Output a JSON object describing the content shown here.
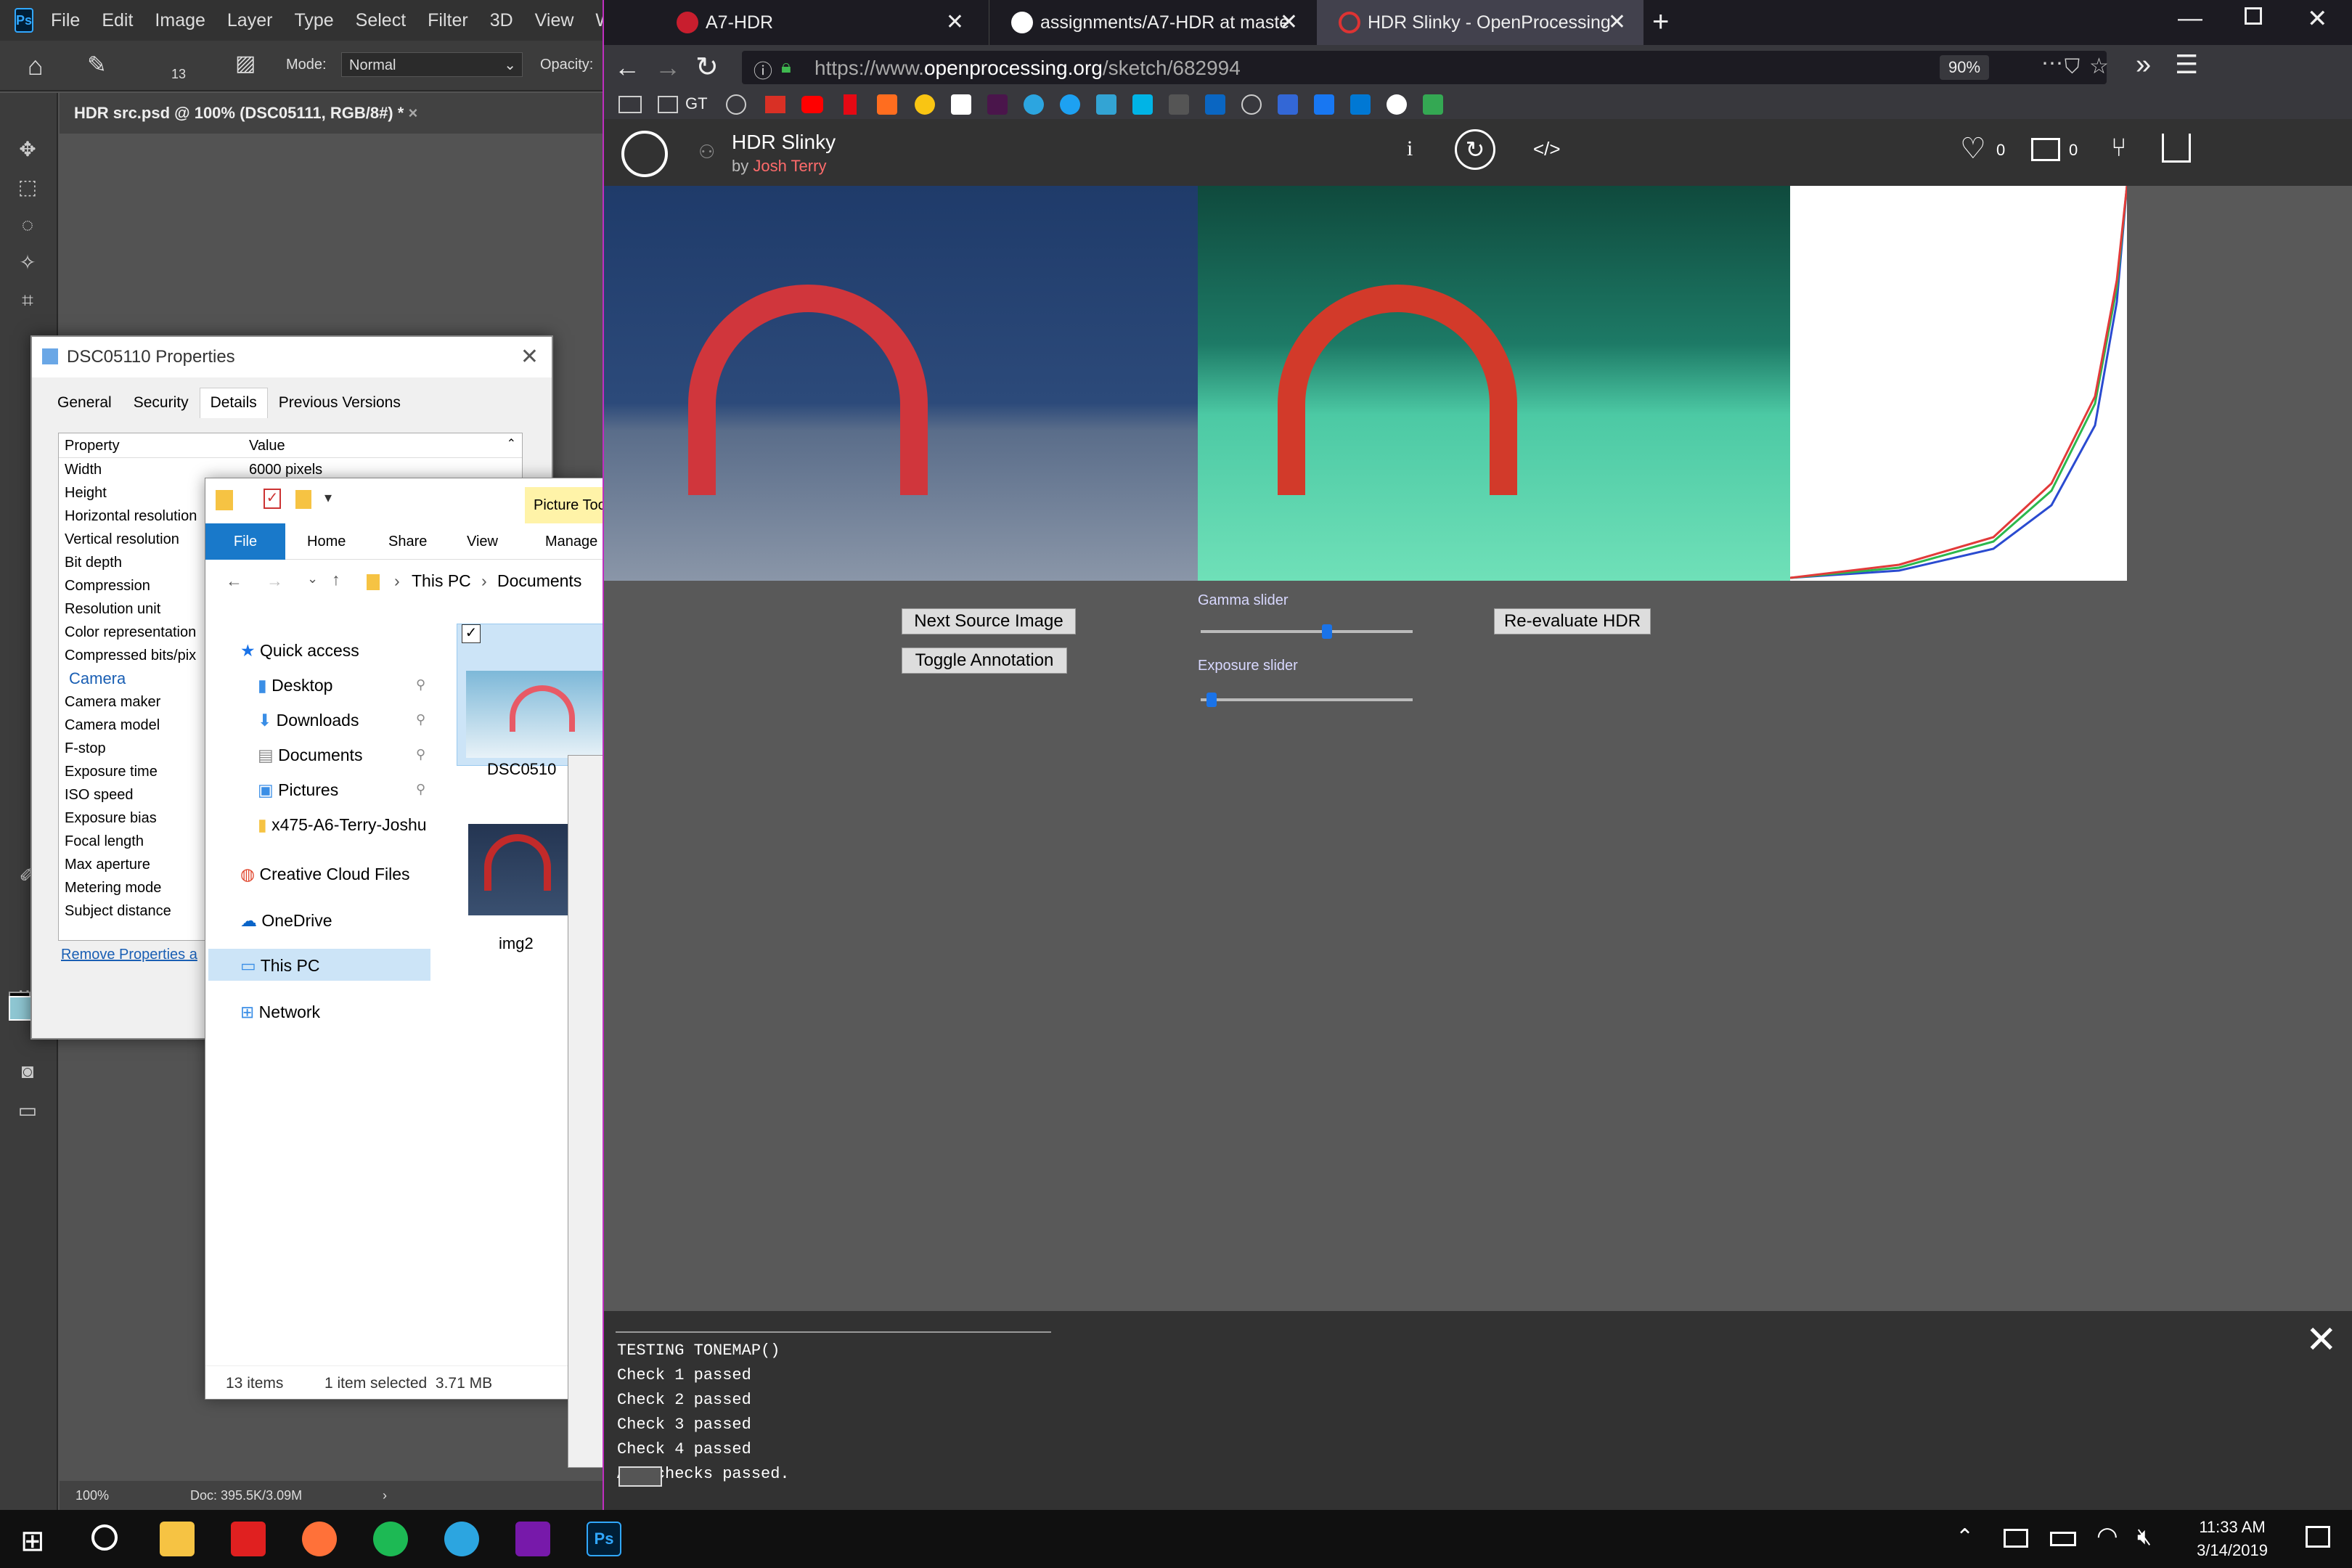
{
  "photoshop": {
    "logo": "Ps",
    "menus": [
      "File",
      "Edit",
      "Image",
      "Layer",
      "Type",
      "Select",
      "Filter",
      "3D",
      "View",
      "Wi"
    ],
    "options": {
      "mode_label": "Mode:",
      "mode_value": "Normal",
      "opacity_label": "Opacity:",
      "brush_size": "13"
    },
    "doc_tab": "HDR src.psd @ 100% (DSC05111, RGB/8#) *",
    "zoom": "100%",
    "doc_size": "Doc: 395.5K/3.09M"
  },
  "properties": {
    "title": "DSC05110 Properties",
    "tabs": [
      "General",
      "Security",
      "Details",
      "Previous Versions"
    ],
    "col_property": "Property",
    "col_value": "Value",
    "rows": [
      "Width",
      "Height",
      "Horizontal resolution",
      "Vertical resolution",
      "Bit depth",
      "Compression",
      "Resolution unit",
      "Color representation",
      "Compressed bits/pix"
    ],
    "width_value": "6000 pixels",
    "camera_section": "Camera",
    "camera_rows": [
      "Camera maker",
      "Camera model",
      "F-stop",
      "Exposure time",
      "ISO speed",
      "Exposure bias",
      "Focal length",
      "Max aperture",
      "Metering mode",
      "Subject distance"
    ],
    "remove_link": "Remove Properties a"
  },
  "explorer": {
    "picture_tools": "Picture Too",
    "ribbon": [
      "File",
      "Home",
      "Share",
      "View",
      "Manage"
    ],
    "path": [
      "This PC",
      "Documents"
    ],
    "quick_access": "Quick access",
    "nav": [
      "Desktop",
      "Downloads",
      "Documents",
      "Pictures",
      "x475-A6-Terry-Joshu"
    ],
    "creative_cloud": "Creative Cloud Files",
    "onedrive": "OneDrive",
    "this_pc": "This PC",
    "network": "Network",
    "files": [
      "DSC0510",
      "img2"
    ],
    "status_items": "13 items",
    "status_selected": "1 item selected  3.71 MB"
  },
  "browser": {
    "tabs": [
      "A7-HDR",
      "assignments/A7-HDR at maste",
      "HDR Slinky - OpenProcessing"
    ],
    "url_prefix": "https://www.",
    "url_domain": "openprocessing.org",
    "url_path": "/sketch/682994",
    "zoom": "90%",
    "bookmark_folder": "GT"
  },
  "sketch": {
    "title": "HDR Slinky",
    "by": "by",
    "author": "Josh Terry",
    "likes": "0",
    "comments": "0",
    "buttons": {
      "next": "Next Source Image",
      "toggle": "Toggle Annotation",
      "reeval": "Re-evaluate HDR"
    },
    "gamma_label": "Gamma slider",
    "exposure_label": "Exposure slider",
    "gamma_value": 0.6,
    "exposure_value": 0.03
  },
  "console": {
    "lines": [
      "TESTING TONEMAP()",
      "Check 1 passed",
      "Check 2 passed",
      "Check 3 passed",
      "Check 4 passed",
      "All checks passed."
    ]
  },
  "taskbar": {
    "time": "11:33 AM",
    "date": "3/14/2019"
  },
  "colors": {
    "firefox_border": "#c02ec0",
    "author": "#ff6b6b",
    "ps_blue": "#31a8ff"
  }
}
